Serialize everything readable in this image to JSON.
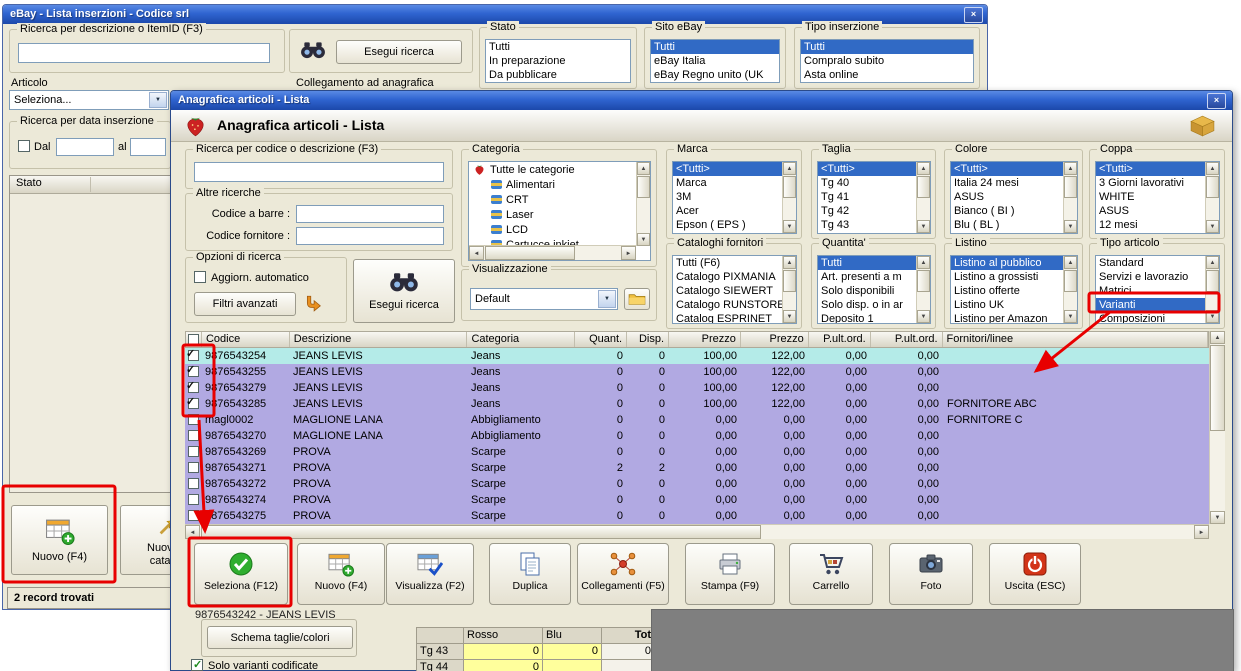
{
  "colors": {
    "annotation_red": "#e80000",
    "titlebar_blue": "#2f64d0",
    "window_bg": "#ece9d8",
    "row_lavender": "#b1a9e2",
    "row_selected_cyan": "#b4ebe8",
    "list_selection_blue": "#316ac5",
    "grid_yellow": "#ffff9c"
  },
  "main_window": {
    "title": "eBay - Lista inserzioni - Codice srl",
    "close_glyph": "×",
    "search_group": {
      "label": "Ricerca per descrizione o ItemID (F3)",
      "value": ""
    },
    "esegui_button": "Esegui ricerca",
    "collegamento_label": "Collegamento ad anagrafica",
    "stato": {
      "label": "Stato",
      "items": [
        "Tutti",
        "In preparazione",
        "Da pubblicare"
      ],
      "selected": -1
    },
    "sito": {
      "label": "Sito eBay",
      "items": [
        "Tutti",
        "eBay Italia",
        "eBay Regno unito (UK"
      ],
      "selected": 0
    },
    "tipo_inserzione": {
      "label": "Tipo inserzione",
      "items": [
        "Tutti",
        "Compralo subito",
        "Asta online"
      ],
      "selected": 0
    },
    "articolo_label": "Articolo",
    "articolo_value": "Seleziona...",
    "data_group": {
      "label": "Ricerca per data inserzione",
      "dal_label": "Dal",
      "dal_value": "",
      "al_label": "al",
      "al_value": ""
    },
    "lista_column": "Stato",
    "nuovo_button": "Nuovo (F4)",
    "catalogo_button_line1": "Nuovo d",
    "catalogo_button_line2": "catalog",
    "status_text": "2 record trovati"
  },
  "dialog": {
    "title": "Anagrafica articoli  - Lista",
    "header_title": "Anagrafica articoli  - Lista",
    "close_glyph": "×",
    "search_group": {
      "label": "Ricerca per codice o descrizione (F3)",
      "value": ""
    },
    "altre_ricerche": {
      "label": "Altre ricerche",
      "barcode_label": "Codice a barre :",
      "barcode_value": "",
      "supplier_label": "Codice fornitore :",
      "supplier_value": ""
    },
    "categoria": {
      "label": "Categoria",
      "root_item": "Tutte le categorie",
      "items": [
        "Alimentari",
        "CRT",
        "Laser",
        "LCD",
        "Cartucce inkjet"
      ]
    },
    "marca": {
      "label": "Marca",
      "items": [
        "<Tutti>",
        "Marca",
        "3M",
        "Acer",
        "Epson ( EPS )"
      ],
      "selected": 0
    },
    "taglia": {
      "label": "Taglia",
      "items": [
        "<Tutti>",
        "Tg 40",
        "Tg 41",
        "Tg 42",
        "Tg 43"
      ],
      "selected": 0
    },
    "colore": {
      "label": "Colore",
      "items": [
        "<Tutti>",
        "Italia 24 mesi",
        "ASUS",
        "Bianco ( BI )",
        "Blu ( BL )"
      ],
      "selected": 0
    },
    "coppa": {
      "label": "Coppa",
      "items": [
        "<Tutti>",
        "3 Giorni lavorativi",
        "WHITE",
        "ASUS",
        "12 mesi"
      ],
      "selected": 0
    },
    "cataloghi": {
      "label": "Cataloghi fornitori",
      "items": [
        "Tutti (F6)",
        "Catalogo PIXMANIA",
        "Catalogo SIEWERT",
        "Catalogo RUNSTORE",
        "Catalog ESPRINET"
      ],
      "selected": -1
    },
    "quantita": {
      "label": "Quantita'",
      "items": [
        "Tutti",
        "Art. presenti a m",
        "Solo disponibili",
        "Solo disp. o in ar",
        "Deposito 1"
      ],
      "selected": 0
    },
    "listino": {
      "label": "Listino",
      "items": [
        "Listino al pubblico",
        "Listino a grossisti",
        "Listino offerte",
        "Listino UK",
        "Listino per Amazon"
      ],
      "selected": 0
    },
    "tipo_articolo": {
      "label": "Tipo articolo",
      "items": [
        "Standard",
        "Servizi e lavorazio",
        "Matrici",
        "Varianti",
        "Composizioni"
      ],
      "selected": 3
    },
    "opzioni": {
      "label": "Opzioni di ricerca",
      "auto_label": "Aggiorn. automatico",
      "filtri_label": "Filtri avanzati"
    },
    "esegui_button": "Esegui ricerca",
    "visualizzazione": {
      "label": "Visualizzazione",
      "value": "Default"
    },
    "table": {
      "columns": [
        "Codice",
        "Descrizione",
        "Categoria",
        "Quant.",
        "Disp.",
        "Prezzo",
        "Prezzo",
        "P.ult.ord.",
        "P.ult.ord.",
        "Fornitori/linee"
      ],
      "rows": [
        {
          "checked": true,
          "selected": true,
          "cells": [
            "9876543254",
            "JEANS LEVIS",
            "Jeans",
            "0",
            "0",
            "100,00",
            "122,00",
            "0,00",
            "0,00",
            ""
          ]
        },
        {
          "checked": true,
          "selected": false,
          "cells": [
            "9876543255",
            "JEANS LEVIS",
            "Jeans",
            "0",
            "0",
            "100,00",
            "122,00",
            "0,00",
            "0,00",
            ""
          ]
        },
        {
          "checked": true,
          "selected": false,
          "cells": [
            "9876543279",
            "JEANS LEVIS",
            "Jeans",
            "0",
            "0",
            "100,00",
            "122,00",
            "0,00",
            "0,00",
            ""
          ]
        },
        {
          "checked": true,
          "selected": false,
          "cells": [
            "9876543285",
            "JEANS LEVIS",
            "Jeans",
            "0",
            "0",
            "100,00",
            "122,00",
            "0,00",
            "0,00",
            "FORNITORE ABC"
          ]
        },
        {
          "checked": false,
          "selected": false,
          "cells": [
            "magl0002",
            "MAGLIONE LANA",
            "Abbigliamento",
            "0",
            "0",
            "0,00",
            "0,00",
            "0,00",
            "0,00",
            "FORNITORE C"
          ]
        },
        {
          "checked": false,
          "selected": false,
          "cells": [
            "9876543270",
            "MAGLIONE LANA",
            "Abbigliamento",
            "0",
            "0",
            "0,00",
            "0,00",
            "0,00",
            "0,00",
            ""
          ]
        },
        {
          "checked": false,
          "selected": false,
          "cells": [
            "9876543269",
            "PROVA",
            "Scarpe",
            "0",
            "0",
            "0,00",
            "0,00",
            "0,00",
            "0,00",
            ""
          ]
        },
        {
          "checked": false,
          "selected": false,
          "cells": [
            "9876543271",
            "PROVA",
            "Scarpe",
            "2",
            "2",
            "0,00",
            "0,00",
            "0,00",
            "0,00",
            ""
          ]
        },
        {
          "checked": false,
          "selected": false,
          "cells": [
            "9876543272",
            "PROVA",
            "Scarpe",
            "0",
            "0",
            "0,00",
            "0,00",
            "0,00",
            "0,00",
            ""
          ]
        },
        {
          "checked": false,
          "selected": false,
          "cells": [
            "9876543274",
            "PROVA",
            "Scarpe",
            "0",
            "0",
            "0,00",
            "0,00",
            "0,00",
            "0,00",
            ""
          ]
        },
        {
          "checked": false,
          "selected": false,
          "cells": [
            "9876543275",
            "PROVA",
            "Scarpe",
            "0",
            "0",
            "0,00",
            "0,00",
            "0,00",
            "0,00",
            ""
          ]
        }
      ]
    },
    "toolbar": {
      "seleziona": "Seleziona (F12)",
      "nuovo": "Nuovo (F4)",
      "visualizza": "Visualizza (F2)",
      "duplica": "Duplica",
      "collegamenti": "Collegamenti (F5)",
      "stampa": "Stampa (F9)",
      "carrello": "Carrello",
      "foto": "Foto",
      "uscita": "Uscita (ESC)"
    },
    "footer": {
      "item_label": "9876543242 - JEANS LEVIS",
      "schema_button": "Schema taglie/colori",
      "varianti_checkbox": "Solo varianti codificate",
      "grid": {
        "col_headers": [
          "Rosso",
          "Blu",
          "Tot"
        ],
        "rows": [
          {
            "label": "Tg 43",
            "rosso": "0",
            "blu": "0",
            "tot": "0"
          },
          {
            "label": "Tg 44",
            "rosso": "0",
            "blu": "",
            "tot": ""
          }
        ]
      }
    }
  }
}
